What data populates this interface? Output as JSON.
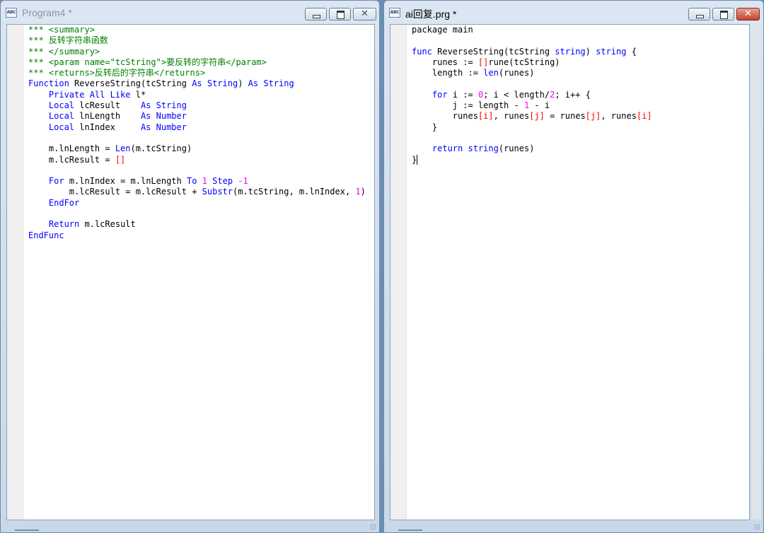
{
  "left_window": {
    "title": "Program4 *",
    "icon": "abc-document-icon",
    "icon_text": "ABC",
    "code": [
      [
        [
          "*** <summary>",
          "#008000"
        ]
      ],
      [
        [
          "*** 反转字符串函数",
          "#008000"
        ]
      ],
      [
        [
          "*** </summary>",
          "#008000"
        ]
      ],
      [
        [
          "*** <param name=\"tcString\">要反转的字符串</param>",
          "#008000"
        ]
      ],
      [
        [
          "*** <returns>反转后的字符串</returns>",
          "#008000"
        ]
      ],
      [
        [
          "Function",
          "#0000ff"
        ],
        [
          " ReverseString(tcString ",
          "#000000"
        ],
        [
          "As String",
          "#0000ff"
        ],
        [
          ") ",
          "#000000"
        ],
        [
          "As String",
          "#0000ff"
        ]
      ],
      [
        [
          "    ",
          "#000000"
        ],
        [
          "Private All Like",
          "#0000ff"
        ],
        [
          " l*",
          "#000000"
        ]
      ],
      [
        [
          "    ",
          "#000000"
        ],
        [
          "Local",
          "#0000ff"
        ],
        [
          " lcResult    ",
          "#000000"
        ],
        [
          "As String",
          "#0000ff"
        ]
      ],
      [
        [
          "    ",
          "#000000"
        ],
        [
          "Local",
          "#0000ff"
        ],
        [
          " lnLength    ",
          "#000000"
        ],
        [
          "As Number",
          "#0000ff"
        ]
      ],
      [
        [
          "    ",
          "#000000"
        ],
        [
          "Local",
          "#0000ff"
        ],
        [
          " lnIndex     ",
          "#000000"
        ],
        [
          "As Number",
          "#0000ff"
        ]
      ],
      [],
      [
        [
          "    m.lnLength = ",
          "#000000"
        ],
        [
          "Len",
          "#0000ff"
        ],
        [
          "(m.tcString)",
          "#000000"
        ]
      ],
      [
        [
          "    m.lcResult = ",
          "#000000"
        ],
        [
          "[]",
          "#ff0000"
        ]
      ],
      [],
      [
        [
          "    ",
          "#000000"
        ],
        [
          "For",
          "#0000ff"
        ],
        [
          " m.lnIndex = m.lnLength ",
          "#000000"
        ],
        [
          "To",
          "#0000ff"
        ],
        [
          " ",
          "#000000"
        ],
        [
          "1",
          "#ff00ff"
        ],
        [
          " ",
          "#000000"
        ],
        [
          "Step",
          "#0000ff"
        ],
        [
          " ",
          "#000000"
        ],
        [
          "-1",
          "#ff00ff"
        ]
      ],
      [
        [
          "        m.lcResult = m.lcResult + ",
          "#000000"
        ],
        [
          "Substr",
          "#0000ff"
        ],
        [
          "(m.tcString, m.lnIndex, ",
          "#000000"
        ],
        [
          "1",
          "#ff00ff"
        ],
        [
          ")",
          "#000000"
        ]
      ],
      [
        [
          "    ",
          "#000000"
        ],
        [
          "EndFor",
          "#0000ff"
        ]
      ],
      [],
      [
        [
          "    ",
          "#000000"
        ],
        [
          "Return",
          "#0000ff"
        ],
        [
          " m.lcResult",
          "#000000"
        ]
      ],
      [
        [
          "EndFunc",
          "#0000ff"
        ]
      ]
    ]
  },
  "right_window": {
    "title": "ai回复.prg *",
    "icon": "abc-document-icon",
    "icon_text": "ABC",
    "code": [
      [
        [
          "package main",
          "#000000"
        ]
      ],
      [],
      [
        [
          "func",
          "#0000ff"
        ],
        [
          " ReverseString(tcString ",
          "#000000"
        ],
        [
          "string",
          "#0000ff"
        ],
        [
          ") ",
          "#000000"
        ],
        [
          "string",
          "#0000ff"
        ],
        [
          " {",
          "#000000"
        ]
      ],
      [
        [
          "    runes := ",
          "#000000"
        ],
        [
          "[]",
          "#ff0000"
        ],
        [
          "rune(tcString)",
          "#000000"
        ]
      ],
      [
        [
          "    length := ",
          "#000000"
        ],
        [
          "len",
          "#0000ff"
        ],
        [
          "(runes)",
          "#000000"
        ]
      ],
      [],
      [
        [
          "    ",
          "#000000"
        ],
        [
          "for",
          "#0000ff"
        ],
        [
          " i := ",
          "#000000"
        ],
        [
          "0",
          "#ff00ff"
        ],
        [
          "; i < length/",
          "#000000"
        ],
        [
          "2",
          "#ff00ff"
        ],
        [
          "; i++ {",
          "#000000"
        ]
      ],
      [
        [
          "        j := length - ",
          "#000000"
        ],
        [
          "1",
          "#ff00ff"
        ],
        [
          " - i",
          "#000000"
        ]
      ],
      [
        [
          "        runes",
          "#000000"
        ],
        [
          "[i]",
          "#ff0000"
        ],
        [
          ", runes",
          "#000000"
        ],
        [
          "[j]",
          "#ff0000"
        ],
        [
          " = runes",
          "#000000"
        ],
        [
          "[j]",
          "#ff0000"
        ],
        [
          ", runes",
          "#000000"
        ],
        [
          "[i]",
          "#ff0000"
        ]
      ],
      [
        [
          "    }",
          "#000000"
        ]
      ],
      [],
      [
        [
          "    ",
          "#000000"
        ],
        [
          "return",
          "#0000ff"
        ],
        [
          " ",
          "#000000"
        ],
        [
          "string",
          "#0000ff"
        ],
        [
          "(runes)",
          "#000000"
        ]
      ],
      [
        [
          "}",
          "#000000"
        ]
      ]
    ]
  },
  "controls": {
    "minimize_icon": "minimize-icon",
    "maximize_icon": "maximize-icon",
    "close_icon": "close-icon",
    "close_glyph": "✕"
  }
}
